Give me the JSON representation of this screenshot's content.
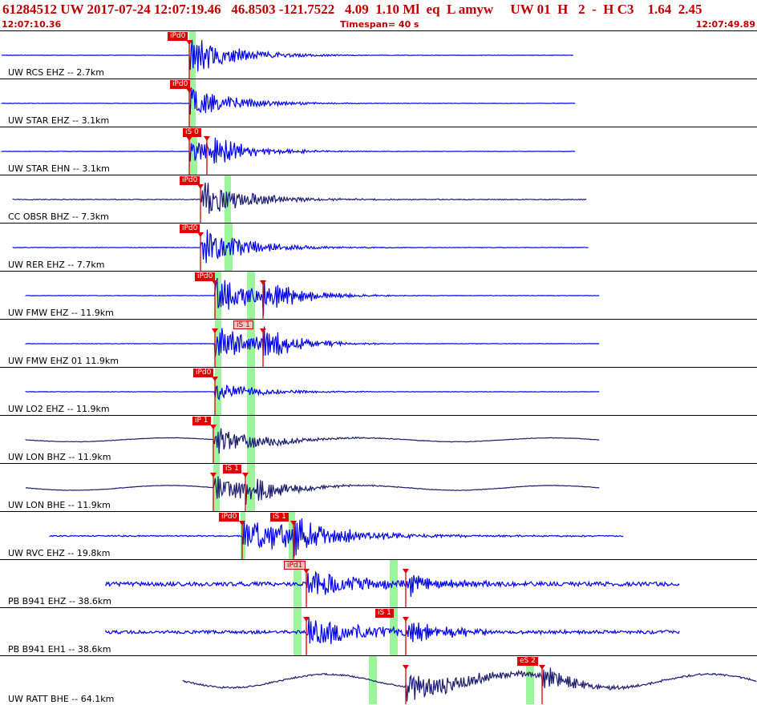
{
  "header": {
    "event_line": "61284512 UW 2017-07-24 12:07:19.46   46.8503 -121.7522   4.09  1.10 Ml  eq  L amyw     UW 01  H   2  -  H C3    1.64  2.45",
    "time_start": "12:07:10.36",
    "timespan": "Timespan=  40 s",
    "time_end": "12:07:49.89"
  },
  "colors": {
    "trace_blue": "#0000ee",
    "trace_navy": "#1a1a6e",
    "pick_red": "#e00000",
    "window_green": "#9cf59c",
    "header_red": "#c00000"
  },
  "channels": [
    {
      "label": "UW RCS EHZ -- 2.7km",
      "color": "blue",
      "picks": [
        {
          "text": "iPd0",
          "style": "solid"
        }
      ]
    },
    {
      "label": "UW STAR EHZ -- 3.1km",
      "color": "blue",
      "picks": [
        {
          "text": "iPd0",
          "style": "solid"
        }
      ]
    },
    {
      "label": "UW STAR EHN -- 3.1km",
      "color": "blue",
      "picks": [
        {
          "text": "iS 0",
          "style": "solid"
        }
      ]
    },
    {
      "label": "CC OBSR BHZ -- 7.3km",
      "color": "navy",
      "picks": [
        {
          "text": "iPd0",
          "style": "solid"
        }
      ]
    },
    {
      "label": "UW RER EHZ -- 7.7km",
      "color": "blue",
      "picks": [
        {
          "text": "iPd0",
          "style": "solid"
        }
      ]
    },
    {
      "label": "UW FMW EHZ -- 11.9km",
      "color": "blue",
      "picks": [
        {
          "text": "iPd0",
          "style": "solid"
        }
      ]
    },
    {
      "label": "UW FMW EHZ 01 11.9km",
      "color": "blue",
      "picks": [
        {
          "text": "iS 1",
          "style": "light"
        }
      ]
    },
    {
      "label": "UW LO2 EHZ -- 11.9km",
      "color": "blue",
      "picks": [
        {
          "text": "iPd0",
          "style": "solid"
        }
      ]
    },
    {
      "label": "UW LON BHZ -- 11.9km",
      "color": "navy",
      "picks": [
        {
          "text": "iP 1",
          "style": "solid"
        }
      ]
    },
    {
      "label": "UW LON BHE -- 11.9km",
      "color": "navy",
      "picks": [
        {
          "text": "iS 1",
          "style": "solid"
        }
      ]
    },
    {
      "label": "UW RVC EHZ -- 19.8km",
      "color": "blue",
      "picks": [
        {
          "text": "iPd0",
          "style": "solid"
        },
        {
          "text": "iS 1",
          "style": "solid"
        }
      ]
    },
    {
      "label": "PB B941 EHZ -- 38.6km",
      "color": "blue",
      "picks": [
        {
          "text": "iPd1",
          "style": "light"
        }
      ]
    },
    {
      "label": "PB B941 EH1 -- 38.6km",
      "color": "blue",
      "picks": [
        {
          "text": "iS 1",
          "style": "solid"
        }
      ]
    },
    {
      "label": "UW RATT BHE -- 64.1km",
      "color": "navy",
      "picks": [
        {
          "text": "eS 2",
          "style": "solid"
        }
      ]
    }
  ]
}
